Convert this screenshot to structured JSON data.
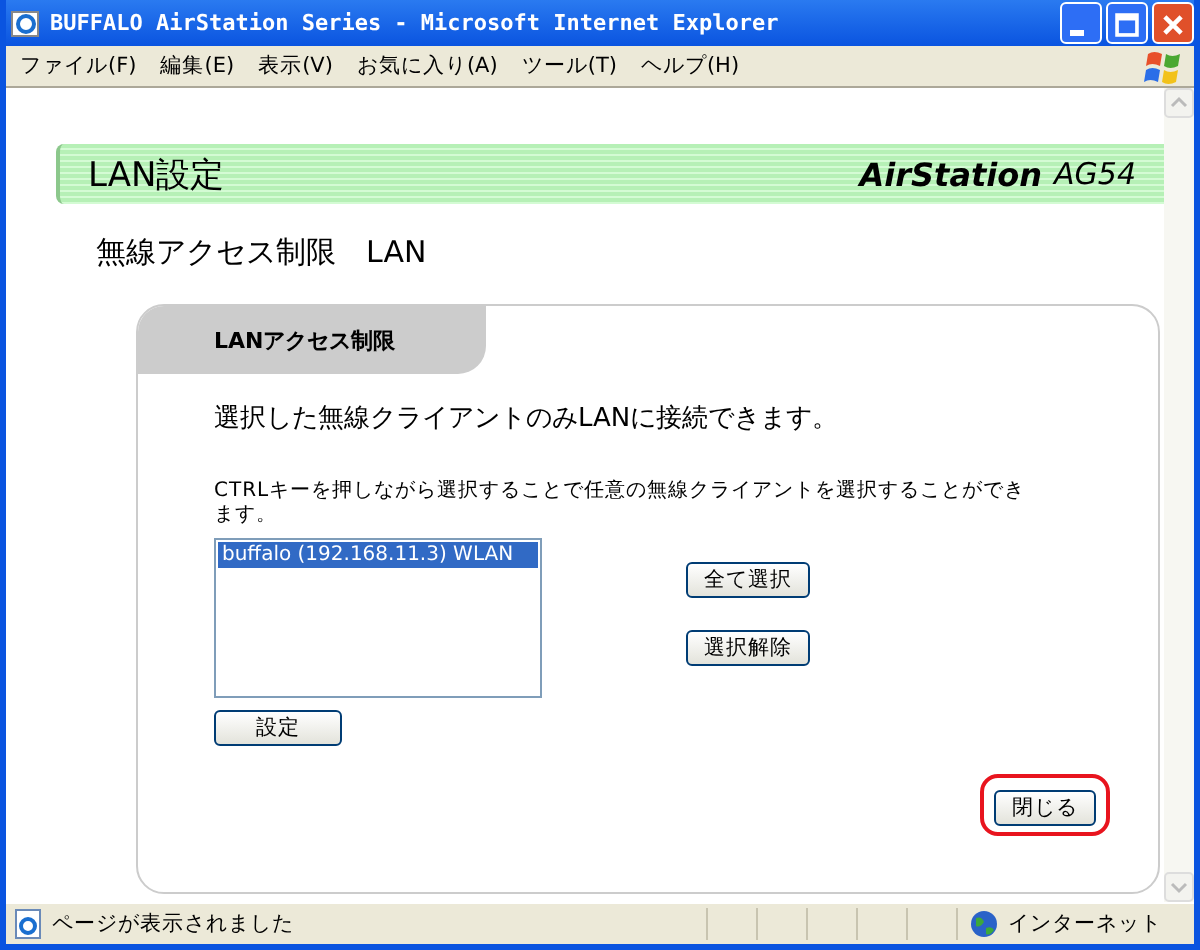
{
  "window": {
    "title": "BUFFALO AirStation Series - Microsoft Internet Explorer"
  },
  "menu": [
    "ファイル(F)",
    "編集(E)",
    "表示(V)",
    "お気に入り(A)",
    "ツール(T)",
    "ヘルプ(H)"
  ],
  "banner": {
    "title": "LAN設定",
    "logo": "AirStation",
    "logo_model": "AG54"
  },
  "heading": "無線アクセス制限　LAN",
  "panel": {
    "tab": "LANアクセス制限",
    "intro": "選択した無線クライアントのみLANに接続できます。",
    "hint": "CTRLキーを押しながら選択することで任意の無線クライアントを選択することができます。",
    "clients": [
      {
        "label": "buffalo (192.168.11.3) WLAN",
        "selected": true
      }
    ],
    "select_all": "全て選択",
    "deselect": "選択解除",
    "apply": "設定",
    "close": "閉じる"
  },
  "status_bar": {
    "message": "ページが表示されました",
    "zone": "インターネット"
  }
}
